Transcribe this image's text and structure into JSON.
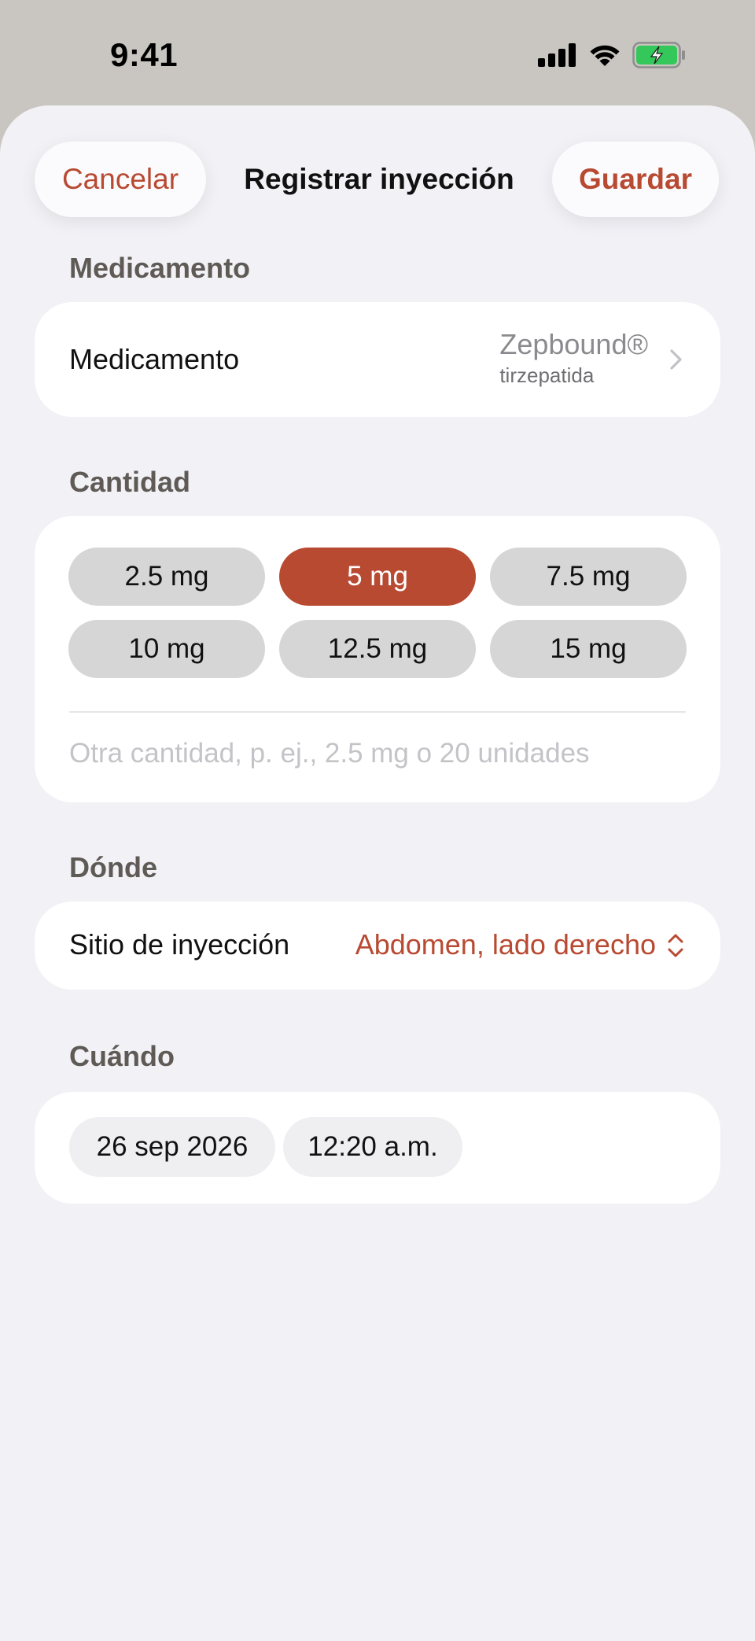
{
  "status_bar": {
    "time": "9:41",
    "icons": [
      "cellular-signal-icon",
      "wifi-icon",
      "battery-charging-icon"
    ]
  },
  "nav": {
    "cancel_label": "Cancelar",
    "title": "Registrar inyección",
    "save_label": "Guardar"
  },
  "medication": {
    "section_title": "Medicamento",
    "row_label": "Medicamento",
    "name": "Zepbound®",
    "generic": "tirzepatida"
  },
  "amount": {
    "section_title": "Cantidad",
    "doses": [
      "2.5 mg",
      "5 mg",
      "7.5 mg",
      "10 mg",
      "12.5 mg",
      "15 mg"
    ],
    "selected_dose": "5 mg",
    "other_value": "",
    "other_placeholder": "Otra cantidad, p. ej., 2.5 mg o 20 unidades"
  },
  "where": {
    "section_title": "Dónde",
    "row_label": "Sitio de inyección",
    "value": "Abdomen, lado derecho"
  },
  "when": {
    "section_title": "Cuándo",
    "date": "26 sep 2026",
    "time": "12:20 a.m."
  },
  "colors": {
    "accent": "#b84a32",
    "sheet_background": "#f1f1f6",
    "card_background": "#ffffff",
    "chip_unselected": "#d6d6d6",
    "battery_green": "#34c759"
  }
}
